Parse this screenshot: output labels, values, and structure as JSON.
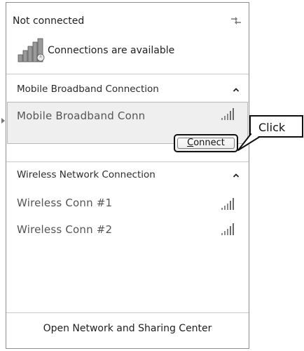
{
  "header": {
    "status": "Not connected",
    "availability": "Connections are available"
  },
  "mobile_section": {
    "title": "Mobile Broadband Connection",
    "items": [
      {
        "label": "Mobile Broadband Conn",
        "icon": "signal-bars-icon",
        "action": "Connect",
        "action_hotkey": "C"
      }
    ]
  },
  "wireless_section": {
    "title": "Wireless Network Connection",
    "items": [
      {
        "label": "Wireless Conn #1",
        "icon": "signal-bars-icon"
      },
      {
        "label": "Wireless Conn #2",
        "icon": "signal-bars-icon"
      }
    ]
  },
  "callout": {
    "text": "Click"
  },
  "footer": {
    "link": "Open Network and Sharing Center"
  }
}
